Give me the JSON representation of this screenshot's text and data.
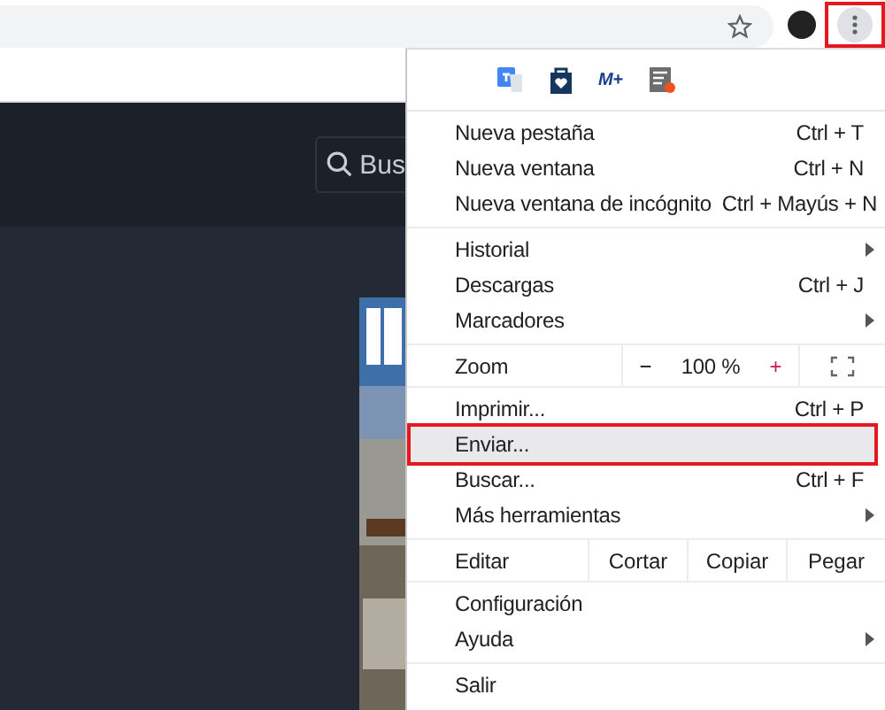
{
  "toolbar": {
    "menu_button": {
      "highlighted": true
    }
  },
  "page": {
    "search": {
      "placeholder": "Bus"
    }
  },
  "menu": {
    "extensions": [
      {
        "kind": "translate"
      },
      {
        "kind": "bag"
      },
      {
        "kind": "text",
        "label": "M+"
      },
      {
        "kind": "notes"
      }
    ],
    "groups": [
      [
        {
          "kind": "item",
          "label": "Nueva pestaña",
          "shortcut": "Ctrl + T",
          "submenu": false,
          "highlighted": false
        },
        {
          "kind": "item",
          "label": "Nueva ventana",
          "shortcut": "Ctrl + N",
          "submenu": false,
          "highlighted": false
        },
        {
          "kind": "item",
          "label": "Nueva ventana de incógnito",
          "shortcut": "Ctrl + Mayús + N",
          "submenu": false,
          "highlighted": false
        }
      ],
      [
        {
          "kind": "item",
          "label": "Historial",
          "submenu": true,
          "highlighted": false
        },
        {
          "kind": "item",
          "label": "Descargas",
          "shortcut": "Ctrl + J",
          "submenu": false,
          "highlighted": false
        },
        {
          "kind": "item",
          "label": "Marcadores",
          "submenu": true,
          "highlighted": false
        }
      ],
      [
        {
          "kind": "zoom",
          "label": "Zoom",
          "minus": "−",
          "value": "100 %",
          "plus": "+"
        }
      ],
      [
        {
          "kind": "item",
          "label": "Imprimir...",
          "shortcut": "Ctrl + P",
          "submenu": false,
          "highlighted": false
        },
        {
          "kind": "item",
          "label": "Enviar...",
          "submenu": false,
          "highlighted": true
        },
        {
          "kind": "item",
          "label": "Buscar...",
          "shortcut": "Ctrl + F",
          "submenu": false,
          "highlighted": false
        },
        {
          "kind": "item",
          "label": "Más herramientas",
          "submenu": true,
          "highlighted": false
        }
      ],
      [
        {
          "kind": "edit",
          "label": "Editar",
          "actions": [
            "Cortar",
            "Copiar",
            "Pegar"
          ]
        }
      ],
      [
        {
          "kind": "item",
          "label": "Configuración",
          "submenu": false,
          "highlighted": false
        },
        {
          "kind": "item",
          "label": "Ayuda",
          "submenu": true,
          "highlighted": false
        }
      ],
      [
        {
          "kind": "item",
          "label": "Salir",
          "submenu": false,
          "highlighted": false
        }
      ]
    ]
  }
}
